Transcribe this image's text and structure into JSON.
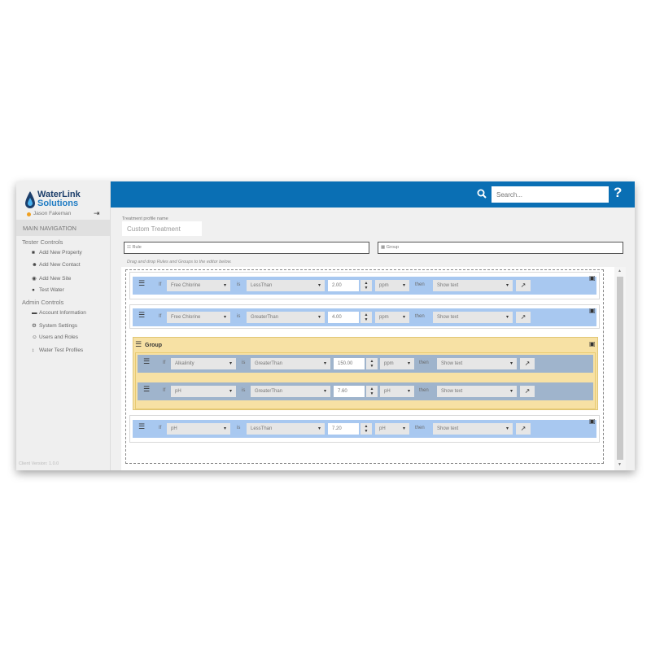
{
  "app": {
    "logo_line1": "WaterLink",
    "logo_line2": "Solutions",
    "user_name": "Jason Fakeman",
    "main_nav_label": "MAIN NAVIGATION",
    "version": "Client Version: 1.0.0"
  },
  "sidebar": {
    "tester_controls": "Tester Controls",
    "tester_items": [
      {
        "label": "Add New Property",
        "icon": "truck-icon"
      },
      {
        "label": "Add New Contact",
        "icon": "user-plus-icon"
      },
      {
        "label": "Add New Site",
        "icon": "site-icon"
      },
      {
        "label": "Test Water",
        "icon": "drop-icon"
      }
    ],
    "admin_controls": "Admin Controls",
    "admin_items": [
      {
        "label": "Account Information",
        "icon": "account-icon"
      },
      {
        "label": "System Settings",
        "icon": "gear-icon"
      },
      {
        "label": "Users and Roles",
        "icon": "users-icon"
      },
      {
        "label": "Water Test Profiles",
        "icon": "profile-icon"
      }
    ]
  },
  "header": {
    "search_placeholder": "Search...",
    "help_label": "?"
  },
  "profile": {
    "label": "Treatment profile name",
    "value": "Custom Treatment"
  },
  "toolbox": {
    "rule_label": "Rule",
    "group_label": "Group",
    "hint": "Drag and drop Rules and Groups to the editor below."
  },
  "keywords": {
    "if": "If",
    "is": "is",
    "then": "then"
  },
  "rules": [
    {
      "param": "Free Chlorine",
      "op": "LessThan",
      "value": "2.00",
      "unit": "ppm",
      "action": "Show text"
    },
    {
      "param": "Free Chlorine",
      "op": "GreaterThan",
      "value": "4.00",
      "unit": "ppm",
      "action": "Show text"
    }
  ],
  "group": {
    "title": "Group",
    "rules": [
      {
        "param": "Alkalinity",
        "op": "GreaterThan",
        "value": "150.00",
        "unit": "ppm",
        "action": "Show text"
      },
      {
        "param": "pH",
        "op": "GreaterThan",
        "value": "7.60",
        "unit": "pH",
        "action": "Show text"
      }
    ]
  },
  "last_rule": {
    "param": "pH",
    "op": "LessThan",
    "value": "7.20",
    "unit": "pH",
    "action": "Show text"
  }
}
